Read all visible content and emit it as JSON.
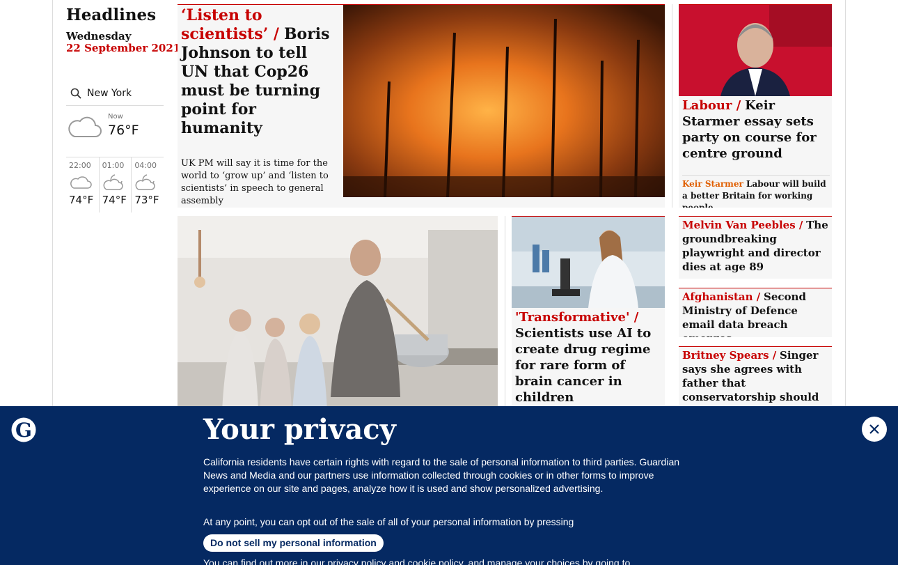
{
  "sidebar": {
    "title": "Headlines",
    "day": "Wednesday",
    "date": "22 September 2021"
  },
  "weather": {
    "location": "New York",
    "now_label": "Now",
    "now_temp": "76°F",
    "forecast": [
      {
        "time": "22:00",
        "temp": "74°F",
        "icon": "cloudy-icon"
      },
      {
        "time": "01:00",
        "temp": "74°F",
        "icon": "partly-cloudy-night-icon"
      },
      {
        "time": "04:00",
        "temp": "73°F",
        "icon": "partly-cloudy-night-icon"
      }
    ]
  },
  "articles": {
    "lead": {
      "kicker": "‘Listen to scientists’ /",
      "headline": "Boris Johnson to tell UN that Cop26 must be turning point for humanity",
      "standfirst": "UK PM will say it is time for the world to ‘grow up’ and ‘listen to scientists’ in speech to general assembly"
    },
    "labour": {
      "kicker": "Labour /",
      "headline": "Keir Starmer essay sets party on course for centre ground",
      "sub_kicker": "Keir Starmer",
      "sub_headline": "Labour will build a better Britain for working people"
    },
    "science": {
      "kicker": "'Transformative' /",
      "headline": "Scientists use AI to create drug regime for rare form of brain cancer in children"
    },
    "small": [
      {
        "kicker": "Melvin Van Peebles /",
        "headline": "The groundbreaking playwright and director dies at age 89"
      },
      {
        "kicker": "Afghanistan /",
        "headline": "Second Ministry of Defence email data breach emerges"
      },
      {
        "kicker": "Britney Spears /",
        "headline": "Singer says she agrees with father that conservatorship should end"
      }
    ]
  },
  "privacy": {
    "title": "Your privacy",
    "para1": "California residents have certain rights with regard to the sale of personal information to third parties. Guardian News and Media and our partners use information collected through cookies or in other forms to improve experience on our site and pages, analyze how it is used and show personalized advertising.",
    "para2": "At any point, you can opt out of the sale of all of your personal information by pressing",
    "button": "Do not sell my personal information",
    "para3": "You can find out more in our privacy policy and cookie policy, and manage your choices by going to"
  },
  "colors": {
    "accent": "#c70000",
    "privacy_bg": "#052962",
    "opinion": "#e05e00"
  }
}
